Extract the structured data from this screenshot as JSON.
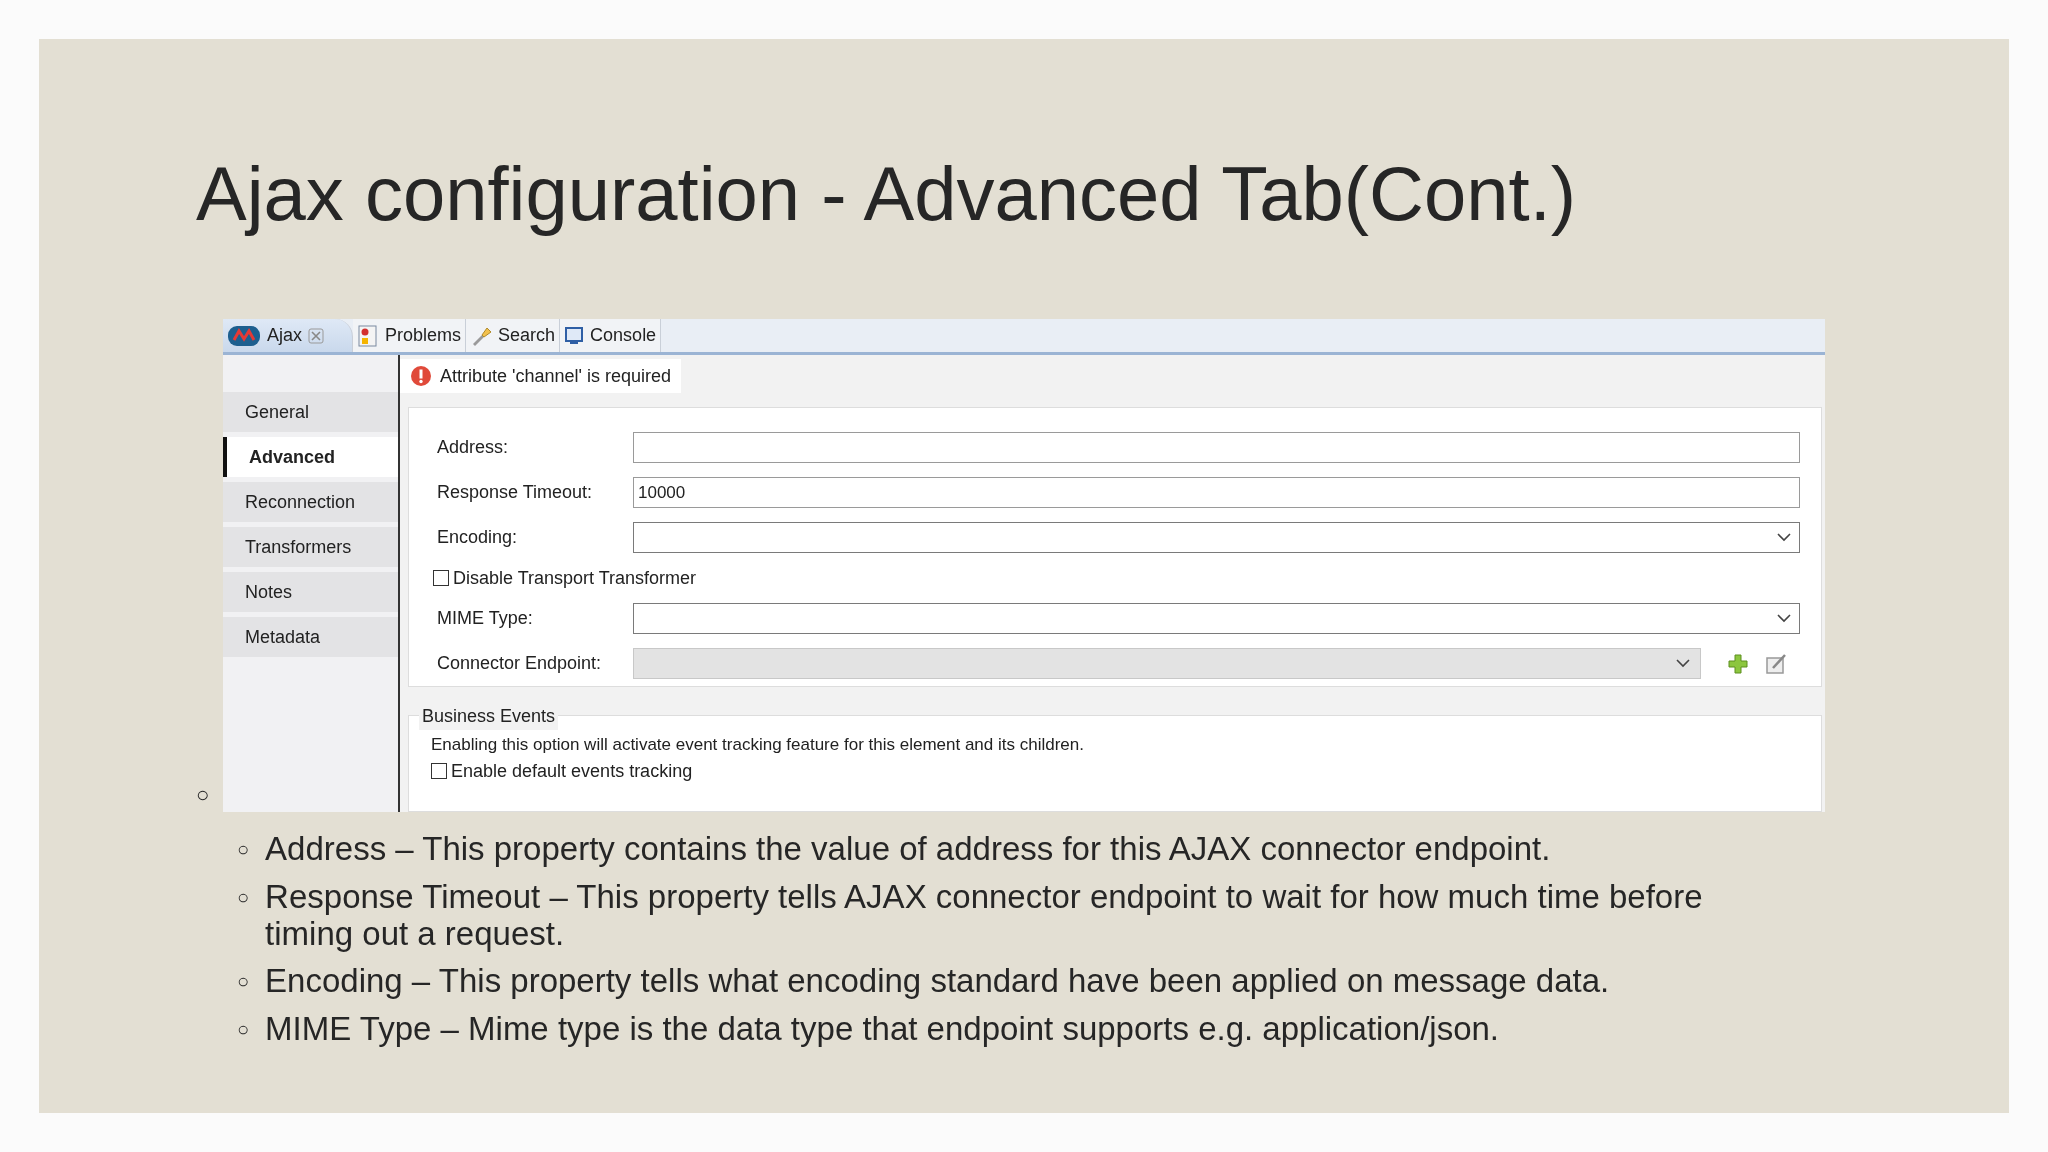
{
  "slide": {
    "title": "Ajax configuration - Advanced Tab(Cont.)",
    "orphan_marker": "○"
  },
  "editor": {
    "tabs": [
      {
        "kind": "ajax",
        "label": "Ajax",
        "selected": true,
        "closable": true
      },
      {
        "kind": "problems",
        "label": "Problems",
        "selected": false,
        "closable": false
      },
      {
        "kind": "search",
        "label": "Search",
        "selected": false,
        "closable": false
      },
      {
        "kind": "console",
        "label": "Console",
        "selected": false,
        "closable": false
      }
    ],
    "error_message": "Attribute 'channel' is required",
    "sidebar": {
      "items": [
        {
          "label": "General",
          "selected": false
        },
        {
          "label": "Advanced",
          "selected": true
        },
        {
          "label": "Reconnection",
          "selected": false
        },
        {
          "label": "Transformers",
          "selected": false
        },
        {
          "label": "Notes",
          "selected": false
        },
        {
          "label": "Metadata",
          "selected": false
        }
      ]
    },
    "form": {
      "fields": [
        {
          "kind": "text",
          "label": "Address:"
        },
        {
          "kind": "text",
          "label": "Response Timeout:",
          "value": "10000"
        },
        {
          "kind": "combo",
          "label": "Encoding:"
        },
        {
          "kind": "checkbox",
          "label": "Disable Transport Transformer",
          "checked": false
        },
        {
          "kind": "combo",
          "label": "MIME Type:"
        },
        {
          "kind": "endpoint",
          "label": "Connector Endpoint:",
          "disabled": true
        }
      ]
    },
    "business_events": {
      "legend": "Business Events",
      "description": "Enabling this option will activate event tracking feature for this element and its children.",
      "checkbox": {
        "label": "Enable default events tracking",
        "checked": false
      }
    }
  },
  "bullets": [
    {
      "marker": "○",
      "text": "Address – This property contains the value of address for this AJAX connector endpoint."
    },
    {
      "marker": "○",
      "text": "Response Timeout – This property tells AJAX connector endpoint to wait for how much time before timing out a request."
    },
    {
      "marker": "○",
      "text": "Encoding – This property tells what encoding standard have been applied on message data."
    },
    {
      "marker": "○",
      "text": "MIME Type – Mime type is the data type that endpoint supports e.g. application/json."
    }
  ]
}
